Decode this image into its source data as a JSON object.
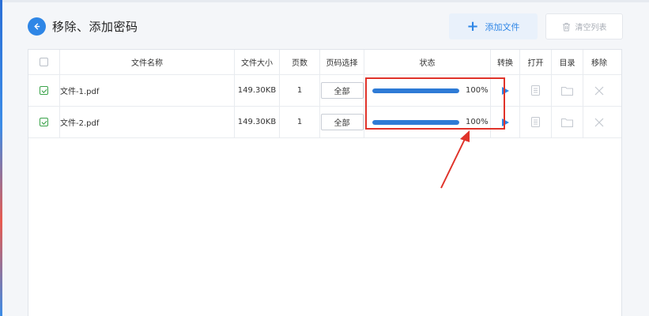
{
  "header": {
    "title": "移除、添加密码",
    "add_label": "添加文件",
    "clear_label": "清空列表"
  },
  "table": {
    "columns": {
      "name": "文件名称",
      "size": "文件大小",
      "pages": "页数",
      "select": "页码选择",
      "status": "状态",
      "convert": "转换",
      "open": "打开",
      "dir": "目录",
      "remove": "移除"
    },
    "rows": [
      {
        "checked": true,
        "name": "文件-1.pdf",
        "size": "149.30KB",
        "pages": "1",
        "select": "全部",
        "progress": 1.0,
        "pct": "100%"
      },
      {
        "checked": true,
        "name": "文件-2.pdf",
        "size": "149.30KB",
        "pages": "1",
        "select": "全部",
        "progress": 1.0,
        "pct": "100%"
      }
    ]
  },
  "colors": {
    "accent": "#2e86e6",
    "progress": "#2e7bd6",
    "annotation": "#e0332a",
    "check": "#2f9c3f"
  }
}
